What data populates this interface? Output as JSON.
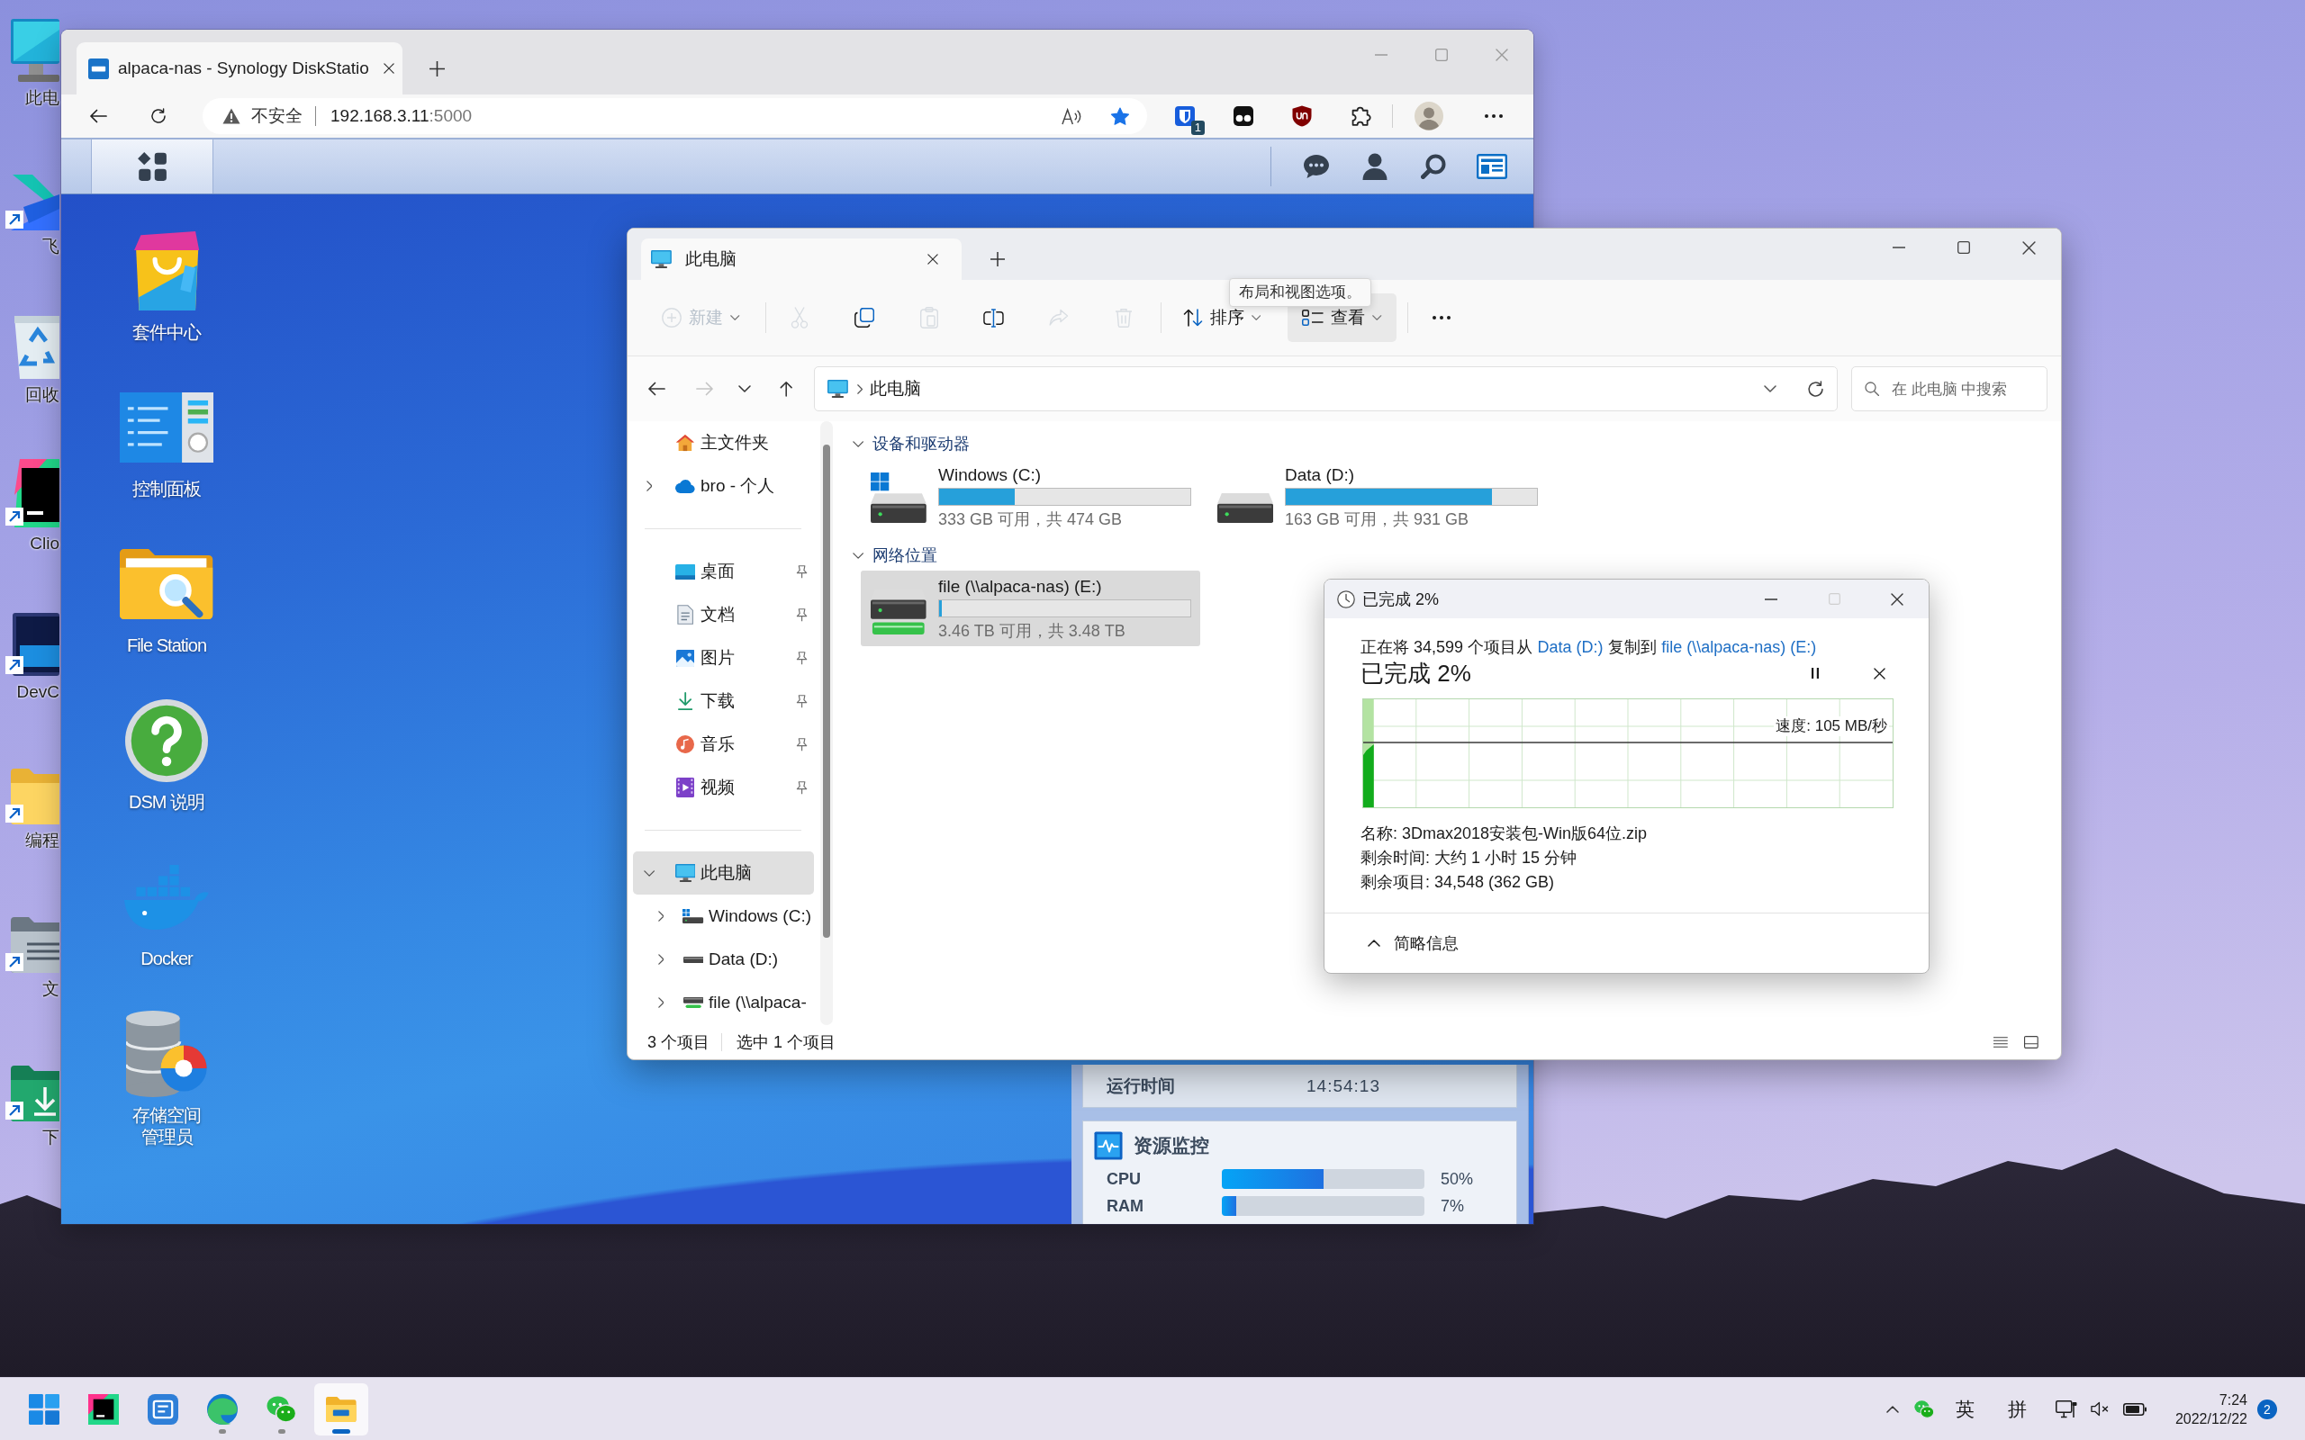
{
  "desktop_icons": [
    {
      "label": "此电",
      "kind": "monitor",
      "shortcut": false
    },
    {
      "label": "飞",
      "kind": "app",
      "shortcut": true
    },
    {
      "label": "回收",
      "kind": "bin",
      "shortcut": false
    },
    {
      "label": "Clio",
      "kind": "ide",
      "shortcut": true
    },
    {
      "label": "DevC",
      "kind": "editor",
      "shortcut": true
    },
    {
      "label": "编程",
      "kind": "folder",
      "shortcut": true
    },
    {
      "label": "文",
      "kind": "documents",
      "shortcut": true
    },
    {
      "label": "下",
      "kind": "downloads",
      "shortcut": true
    }
  ],
  "browser": {
    "tab": {
      "title": "alpaca-nas - Synology DiskStatio",
      "selected": true
    },
    "address": {
      "security": "不安全",
      "host": "192.168.3.11",
      "port": ":5000"
    },
    "favorite": true,
    "extension_badge": "1",
    "dsm": {
      "apps": [
        {
          "label": "套件中心",
          "kind": "package-center"
        },
        {
          "label": "控制面板",
          "kind": "control-panel"
        },
        {
          "label": "File Station",
          "kind": "file-station"
        },
        {
          "label": "DSM 说明",
          "kind": "help"
        },
        {
          "label": "Docker",
          "kind": "docker"
        },
        {
          "label": "存储空间管理员",
          "kind": "storage-manager"
        }
      ],
      "uptime": {
        "label": "运行时间",
        "value": "14:54:13"
      },
      "resource_monitor": {
        "title": "资源监控",
        "meters": [
          {
            "name": "CPU",
            "level": 0.5,
            "reading": "50%"
          },
          {
            "name": "RAM",
            "level": 0.07,
            "reading": "7%"
          }
        ]
      }
    }
  },
  "explorer": {
    "tab": {
      "title": "此电脑",
      "selected": true
    },
    "toolbar": [
      {
        "kind": "new",
        "label": "新建",
        "disabled": true,
        "hovered": false
      },
      {
        "kind": "separator"
      },
      {
        "kind": "cut",
        "disabled": true,
        "hovered": false
      },
      {
        "kind": "copy",
        "disabled": false,
        "hovered": false
      },
      {
        "kind": "paste",
        "disabled": true,
        "hovered": false
      },
      {
        "kind": "rename",
        "disabled": false,
        "hovered": false
      },
      {
        "kind": "share",
        "disabled": true,
        "hovered": false
      },
      {
        "kind": "delete",
        "disabled": true,
        "hovered": false
      },
      {
        "kind": "separator"
      },
      {
        "kind": "sort",
        "label": "排序",
        "disabled": false,
        "hovered": false
      },
      {
        "kind": "view",
        "label": "查看",
        "disabled": false,
        "hovered": true
      },
      {
        "kind": "separator"
      },
      {
        "kind": "more",
        "disabled": false,
        "hovered": false
      }
    ],
    "tooltip": "布局和视图选项。",
    "nav_buttons": [
      {
        "kind": "back",
        "disabled": false
      },
      {
        "kind": "forward",
        "disabled": true
      },
      {
        "kind": "recent",
        "disabled": false
      },
      {
        "kind": "up",
        "disabled": false
      }
    ],
    "breadcrumb": [
      "此电脑"
    ],
    "search_placeholder": "在 此电脑 中搜索",
    "sidebar": [
      {
        "items": [
          {
            "label": "主文件夹",
            "kind": "home",
            "selected": false,
            "pinned": false
          },
          {
            "label": "bro - 个人",
            "kind": "cloud",
            "selected": false,
            "pinned": false,
            "expanded": false
          }
        ]
      },
      {
        "items": [
          {
            "label": "桌面",
            "kind": "desktop",
            "selected": false,
            "pinned": true
          },
          {
            "label": "文档",
            "kind": "documents",
            "selected": false,
            "pinned": true
          },
          {
            "label": "图片",
            "kind": "pictures",
            "selected": false,
            "pinned": true
          },
          {
            "label": "下载",
            "kind": "downloads",
            "selected": false,
            "pinned": true
          },
          {
            "label": "音乐",
            "kind": "music",
            "selected": false,
            "pinned": true
          },
          {
            "label": "视频",
            "kind": "videos",
            "selected": false,
            "pinned": true
          }
        ]
      },
      {
        "items": [
          {
            "label": "此电脑",
            "kind": "computer",
            "selected": true,
            "pinned": false,
            "expanded": true,
            "children": [
              {
                "label": "Windows (C:)",
                "kind": "system-drive",
                "selected": false,
                "pinned": false,
                "expanded": false
              },
              {
                "label": "Data (D:)",
                "kind": "drive",
                "selected": false,
                "pinned": false,
                "expanded": false
              },
              {
                "label": "file (\\\\alpaca-",
                "kind": "network-drive",
                "selected": false,
                "pinned": false,
                "expanded": false
              }
            ]
          }
        ]
      }
    ],
    "groups": [
      {
        "title": "设备和驱动器",
        "expanded": true,
        "drives": [
          {
            "name": "Windows (C:)",
            "kind": "system-drive",
            "level": 0.3,
            "space": "333 GB 可用，共 474 GB",
            "selected": false
          },
          {
            "name": "Data (D:)",
            "kind": "drive",
            "level": 0.82,
            "space": "163 GB 可用，共 931 GB",
            "selected": false
          }
        ]
      },
      {
        "title": "网络位置",
        "expanded": true,
        "drives": [
          {
            "name": "file (\\\\alpaca-nas) (E:)",
            "kind": "network-drive",
            "level": 0.01,
            "space": "3.46 TB 可用，共 3.48 TB",
            "selected": true
          }
        ]
      }
    ],
    "status": {
      "items": "3 个项目",
      "selection": "选中 1 个项目"
    }
  },
  "copy_dialog": {
    "title": "已完成 2%",
    "window_buttons": [
      {
        "kind": "minimize",
        "disabled": false
      },
      {
        "kind": "maximize",
        "disabled": true
      },
      {
        "kind": "close",
        "disabled": false
      }
    ],
    "summary": {
      "prefix": "正在将 34,599 个项目从",
      "source": "Data (D:)",
      "middle": "复制到",
      "destination": "file (\\\\alpaca-nas) (E:)"
    },
    "heading": "已完成 2%",
    "progress": {
      "level": 0.02
    },
    "speed": "速度: 105 MB/秒",
    "details": [
      "名称: 3Dmax2018安装包-Win版64位.zip",
      "剩余时间: 大约 1 小时 15 分钟",
      "剩余项目: 34,548 (362 GB)"
    ],
    "details_toggle": {
      "label": "简略信息",
      "expanded": true
    }
  },
  "taskbar": {
    "apps": [
      {
        "kind": "start",
        "running": false,
        "active": false
      },
      {
        "kind": "clion",
        "running": false,
        "active": false
      },
      {
        "kind": "dictionary",
        "running": false,
        "active": false
      },
      {
        "kind": "edge",
        "running": true,
        "active": false
      },
      {
        "kind": "wechat",
        "running": true,
        "active": false
      },
      {
        "kind": "explorer",
        "running": true,
        "active": true
      }
    ],
    "tray": {
      "input_language": "英",
      "input_mode": "拼",
      "time": "7:24",
      "date": "2022/12/22",
      "notification_count": "2"
    }
  }
}
